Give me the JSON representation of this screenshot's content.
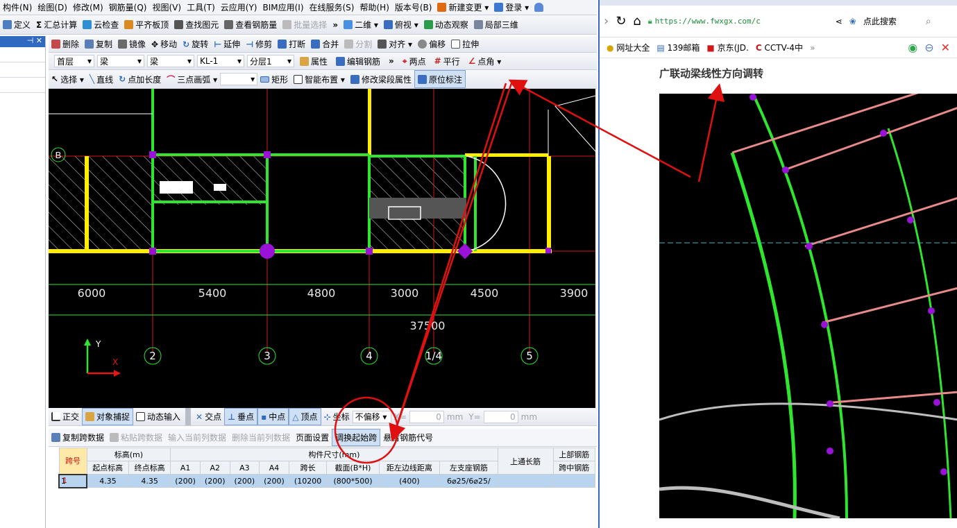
{
  "menu": [
    "构件(N)",
    "绘图(D)",
    "修改(M)",
    "钢筋量(Q)",
    "视图(V)",
    "工具(T)",
    "云应用(Y)",
    "BIM应用(I)",
    "在线服务(S)",
    "帮助(H)",
    "版本号(B)",
    "新建变更 ▾",
    "登录 ▾"
  ],
  "toolbar1": [
    "定义",
    "汇总计算",
    "云检查",
    "平齐板顶",
    "查找图元",
    "查看钢筋量",
    "批量选择",
    "二维 ▾",
    "俯视 ▾",
    "动态观察",
    "局部三维"
  ],
  "toolbar2": [
    "删除",
    "复制",
    "镜像",
    "移动",
    "旋转",
    "延伸",
    "修剪",
    "打断",
    "合并",
    "分割",
    "对齐 ▾",
    "偏移",
    "拉伸"
  ],
  "toolbar3": {
    "floor": "首层",
    "type1": "梁",
    "type2": "梁",
    "name": "KL-1",
    "layer": "分层1",
    "btns": [
      "属性",
      "编辑钢筋",
      "两点",
      "平行",
      "点角 ▾"
    ]
  },
  "toolbar4": [
    "选择 ▾",
    "直线",
    "点加长度",
    "三点画弧 ▾",
    "",
    "矩形",
    "智能布置 ▾",
    "修改梁段属性",
    "原位标注"
  ],
  "canvas": {
    "axis_b": "B",
    "dims": [
      "6000",
      "5400",
      "4800",
      "3000",
      "4500",
      "3900"
    ],
    "total": "37500",
    "axis_nums": [
      "2",
      "3",
      "4",
      "1/4",
      "5"
    ]
  },
  "snapbar": [
    "正交",
    "对象捕捉",
    "动态输入",
    "交点",
    "垂点",
    "中点",
    "顶点",
    "坐标",
    "不偏移 ▾",
    "X=",
    "0",
    "mm",
    "Y=",
    "0",
    "mm"
  ],
  "tabletools": [
    "复制跨数据",
    "粘贴跨数据",
    "输入当前列数据",
    "删除当前列数据",
    "页面设置",
    "调换起始跨",
    "悬臂钢筋代号"
  ],
  "table": {
    "h1": [
      "跨号",
      "标高(m)",
      "构件尺寸(mm)",
      "上通长筋",
      "上部钢筋"
    ],
    "h2": [
      "起点标高",
      "终点标高",
      "A1",
      "A2",
      "A3",
      "A4",
      "跨长",
      "截面(B*H)",
      "距左边线距离",
      "左支座钢筋",
      "跨中钢筋"
    ],
    "row": [
      "1",
      "1",
      "4.35",
      "4.35",
      "(200)",
      "(200)",
      "(200)",
      "(200)",
      "(10200",
      "(800*500)",
      "(400)",
      "6⌀25/6⌀25/",
      "",
      ""
    ]
  },
  "browser": {
    "url": "https://www.fwxgx.com/c",
    "search": "点此搜索",
    "bookmarks": [
      "网址大全",
      "139邮箱",
      "京东(JD.",
      "CCTV-4中"
    ],
    "title": "广联动梁线性方向调转"
  },
  "colors": {
    "beam_yellow": "#ffee00",
    "beam_green": "#2ee62e",
    "axis_red": "#d91616",
    "annot_red": "#e01010",
    "node_purple": "#9a12d8"
  }
}
